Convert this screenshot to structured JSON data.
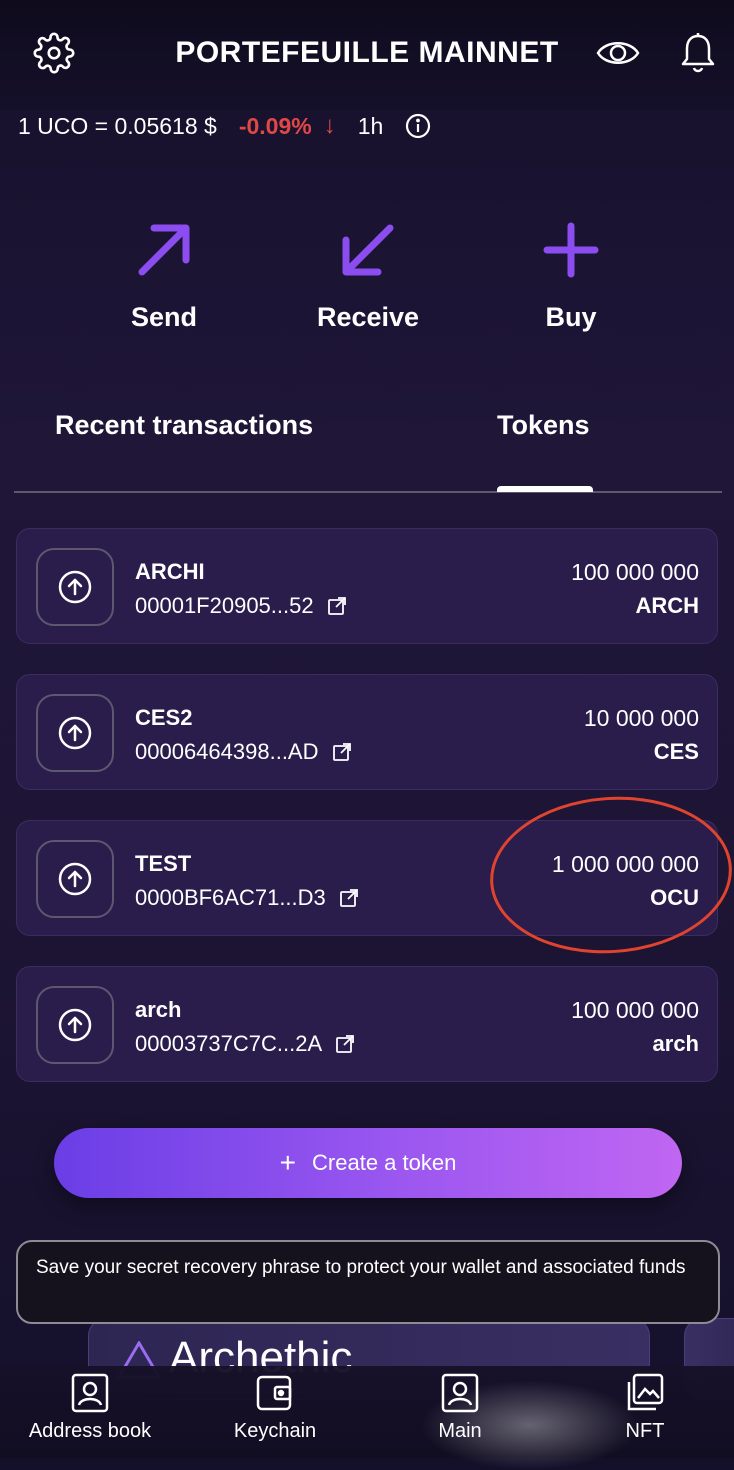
{
  "header": {
    "title": "PORTEFEUILLE MAINNET",
    "icons": [
      "gear-icon",
      "eye-icon",
      "bell-icon"
    ]
  },
  "price": {
    "rate": "1 UCO = 0.05618 $",
    "change": "-0.09%",
    "period": "1h",
    "change_color": "#e04848"
  },
  "actions": [
    {
      "label": "Send",
      "icon": "arrow-up-right-icon"
    },
    {
      "label": "Receive",
      "icon": "arrow-down-left-icon"
    },
    {
      "label": "Buy",
      "icon": "plus-icon"
    }
  ],
  "tabs": [
    {
      "label": "Recent transactions",
      "active": false
    },
    {
      "label": "Tokens",
      "active": true
    }
  ],
  "tokens": [
    {
      "name": "ARCHI",
      "address": "00001F20905...52",
      "amount": "100 000 000",
      "symbol": "ARCH"
    },
    {
      "name": "CES2",
      "address": "00006464398...AD",
      "amount": "10 000 000",
      "symbol": "CES"
    },
    {
      "name": "TEST",
      "address": "0000BF6AC71...D3",
      "amount": "1 000 000 000",
      "symbol": "OCU"
    },
    {
      "name": "arch",
      "address": "00003737C7C...2A",
      "amount": "100 000 000",
      "symbol": "arch"
    }
  ],
  "create_button": {
    "label": "Create a token"
  },
  "notice": {
    "text": "Save your secret recovery phrase to protect your wallet and associated funds"
  },
  "banner": {
    "text": "Archethic"
  },
  "nav": [
    {
      "label": "Address book",
      "icon": "address-book-icon"
    },
    {
      "label": "Keychain",
      "icon": "keychain-icon"
    },
    {
      "label": "Main",
      "icon": "main-icon",
      "active": true
    },
    {
      "label": "NFT",
      "icon": "nft-icon"
    }
  ],
  "colors": {
    "accent": "#8b4df0",
    "card": "#2a1d4c",
    "highlight": "#e0442f"
  }
}
